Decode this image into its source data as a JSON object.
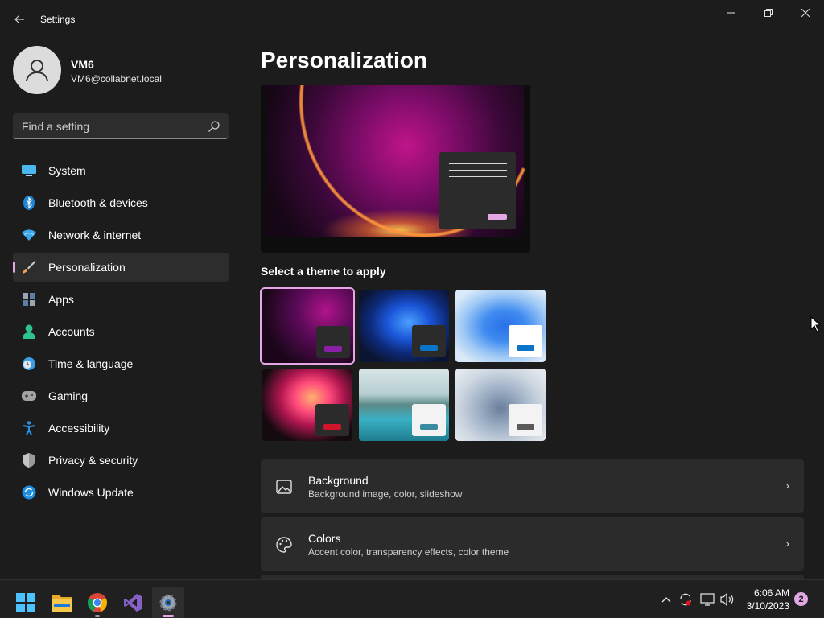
{
  "window": {
    "app_title": "Settings",
    "back_icon": "back-arrow-icon",
    "controls": [
      "minimize-icon",
      "restore-icon",
      "close-icon"
    ]
  },
  "profile": {
    "name": "VM6",
    "email": "VM6@collabnet.local",
    "avatar_icon": "user-icon"
  },
  "search": {
    "placeholder": "Find a setting",
    "icon": "search-icon"
  },
  "nav": {
    "items": [
      {
        "label": "System",
        "icon": "system-icon",
        "active": false
      },
      {
        "label": "Bluetooth & devices",
        "icon": "bluetooth-icon",
        "active": false
      },
      {
        "label": "Network & internet",
        "icon": "wifi-icon",
        "active": false
      },
      {
        "label": "Personalization",
        "icon": "brush-icon",
        "active": true
      },
      {
        "label": "Apps",
        "icon": "apps-icon",
        "active": false
      },
      {
        "label": "Accounts",
        "icon": "accounts-icon",
        "active": false
      },
      {
        "label": "Time & language",
        "icon": "time-language-icon",
        "active": false
      },
      {
        "label": "Gaming",
        "icon": "gamepad-icon",
        "active": false
      },
      {
        "label": "Accessibility",
        "icon": "accessibility-icon",
        "active": false
      },
      {
        "label": "Privacy & security",
        "icon": "shield-icon",
        "active": false
      },
      {
        "label": "Windows Update",
        "icon": "update-icon",
        "active": false
      }
    ]
  },
  "main": {
    "page_title": "Personalization",
    "select_theme_label": "Select a theme to apply",
    "themes": [
      {
        "name": "theme-glow-dark",
        "selected": true,
        "accent": "#8a1fa8"
      },
      {
        "name": "theme-bloom-dark",
        "selected": false,
        "accent": "#0a74c8"
      },
      {
        "name": "theme-bloom-light",
        "selected": false,
        "accent": "#0a74c8"
      },
      {
        "name": "theme-captured-motion",
        "selected": false,
        "accent": "#d0142c"
      },
      {
        "name": "theme-flow",
        "selected": false,
        "accent": "#3a8aa0"
      },
      {
        "name": "theme-sunrise",
        "selected": false,
        "accent": "#5a5a5a"
      }
    ],
    "cards": [
      {
        "title": "Background",
        "subtitle": "Background image, color, slideshow",
        "icon": "image-icon"
      },
      {
        "title": "Colors",
        "subtitle": "Accent color, transparency effects, color theme",
        "icon": "palette-icon"
      }
    ]
  },
  "taskbar": {
    "apps": [
      {
        "name": "start-button",
        "icon": "windows-logo-icon"
      },
      {
        "name": "file-explorer",
        "icon": "folder-icon"
      },
      {
        "name": "chrome",
        "icon": "chrome-icon"
      },
      {
        "name": "visual-studio",
        "icon": "visual-studio-icon"
      },
      {
        "name": "settings",
        "icon": "gear-icon"
      }
    ],
    "tray": [
      "chevron-up-icon",
      "sync-icon",
      "display-icon",
      "volume-icon"
    ],
    "time": "6:06 AM",
    "date": "3/10/2023",
    "notification_count": "2"
  },
  "colors": {
    "accent": "#e3a7e4",
    "background": "#1c1c1c",
    "card": "#2b2b2b"
  }
}
